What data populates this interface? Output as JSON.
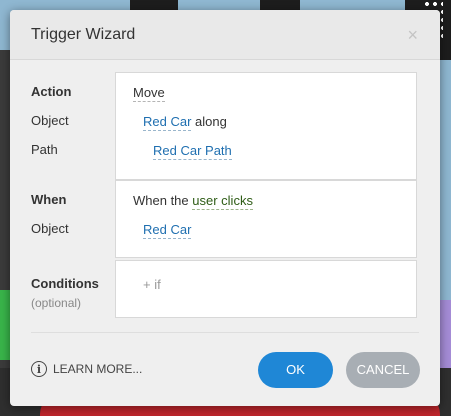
{
  "dialog": {
    "title": "Trigger Wizard",
    "close_glyph": "×"
  },
  "action_section": {
    "labels": {
      "action": "Action",
      "object": "Object",
      "path": "Path"
    },
    "action_value": "Move",
    "object_value": "Red Car",
    "object_suffix": "along",
    "path_value": "Red Car Path"
  },
  "when_section": {
    "labels": {
      "when": "When",
      "object": "Object"
    },
    "when_prefix": "When the",
    "when_value": "user clicks",
    "object_value": "Red Car"
  },
  "conditions_section": {
    "labels": {
      "conditions": "Conditions",
      "optional": "(optional)"
    },
    "add_if": "+ if"
  },
  "footer": {
    "learn_more": "LEARN MORE...",
    "info_glyph": "i",
    "ok_label": "OK",
    "cancel_label": "CANCEL"
  },
  "colors": {
    "ok_button": "#1f87d6",
    "cancel_button": "#a8aeb4",
    "link": "#1f6fb0"
  }
}
